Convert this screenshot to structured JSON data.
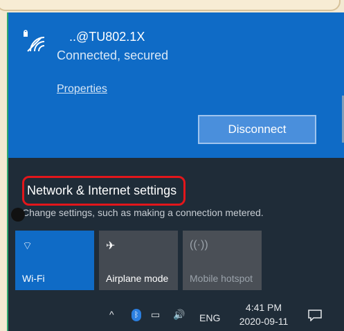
{
  "wifi": {
    "network_name": "..@TU802.1X",
    "status": "Connected, secured",
    "properties_link": "Properties",
    "disconnect_label": "Disconnect",
    "accent": "#0f6bc6"
  },
  "settings": {
    "link_label": "Network & Internet settings",
    "description": "Change settings, such as making a connection metered.",
    "highlight_color": "#e3161b"
  },
  "quick_actions": [
    {
      "label": "Wi-Fi",
      "icon": "wifi-icon",
      "active": true
    },
    {
      "label": "Airplane mode",
      "icon": "airplane-icon",
      "active": false
    },
    {
      "label": "Mobile hotspot",
      "icon": "hotspot-icon",
      "active": false,
      "disabled": true
    }
  ],
  "taskbar": {
    "language": "ENG",
    "time": "4:41 PM",
    "date": "2020-09-11",
    "icons": [
      "chevron-up-icon",
      "bluetooth-icon",
      "network-icon",
      "volume-icon",
      "notification-icon"
    ]
  }
}
